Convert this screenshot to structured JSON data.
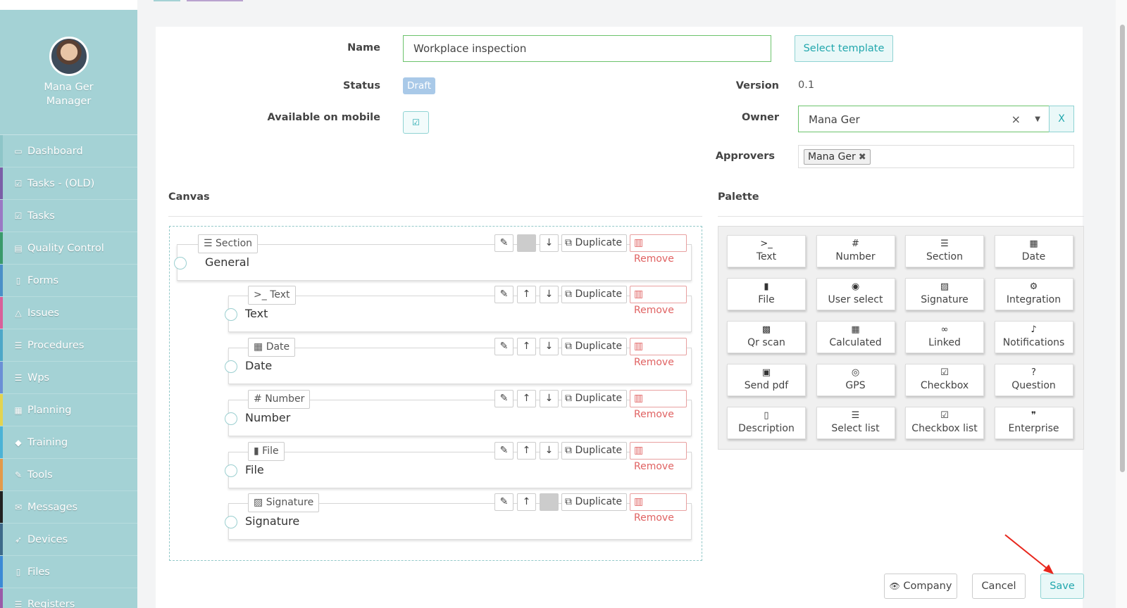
{
  "sidebar": {
    "user_name": "Mana Ger",
    "user_role": "Manager",
    "items": [
      {
        "label": "Dashboard",
        "icon": "monitor-icon",
        "glyph": "▭",
        "color": "#8ec5c8"
      },
      {
        "label": "Tasks - (OLD)",
        "icon": "check-square-icon",
        "glyph": "☑",
        "color": "#7b5ea7"
      },
      {
        "label": "Tasks",
        "icon": "check-square-icon",
        "glyph": "☑",
        "color": "#9a78c4"
      },
      {
        "label": "Quality Control",
        "icon": "book-icon",
        "glyph": "▤",
        "color": "#3a9a6b"
      },
      {
        "label": "Forms",
        "icon": "file-icon",
        "glyph": "▯",
        "color": "#4a90c8"
      },
      {
        "label": "Issues",
        "icon": "bell-icon",
        "glyph": "△",
        "color": "#d9609a"
      },
      {
        "label": "Procedures",
        "icon": "list-icon",
        "glyph": "☰",
        "color": "#4da7c8"
      },
      {
        "label": "Wps",
        "icon": "list-icon",
        "glyph": "☰",
        "color": "#6b8fd6"
      },
      {
        "label": "Planning",
        "icon": "calendar-icon",
        "glyph": "▦",
        "color": "#e3d450"
      },
      {
        "label": "Training",
        "icon": "graduation-icon",
        "glyph": "◆",
        "color": "#4bb3d6"
      },
      {
        "label": "Tools",
        "icon": "wrench-icon",
        "glyph": "✎",
        "color": "#e39a4a"
      },
      {
        "label": "Messages",
        "icon": "envelope-icon",
        "glyph": "✉",
        "color": "#222222"
      },
      {
        "label": "Devices",
        "icon": "rocket-icon",
        "glyph": "➶",
        "color": "#3e6a8a"
      },
      {
        "label": "Files",
        "icon": "pdf-icon",
        "glyph": "▯",
        "color": "#3c8ad6"
      },
      {
        "label": "Registers",
        "icon": "list-icon",
        "glyph": "☰",
        "color": "#9a5aa8"
      }
    ]
  },
  "form": {
    "name_label": "Name",
    "name_value": "Workplace inspection",
    "select_template": "Select template",
    "status_label": "Status",
    "status_value": "Draft",
    "version_label": "Version",
    "version_value": "0.1",
    "mobile_label": "Available on mobile",
    "owner_label": "Owner",
    "owner_value": "Mana Ger",
    "owner_clear": "×",
    "owner_x": "X",
    "approvers_label": "Approvers",
    "approver_tag": "Mana Ger"
  },
  "canvas": {
    "title": "Canvas",
    "components": [
      {
        "type": "Section",
        "type_glyph": "☰",
        "label": "General",
        "up_disabled": true,
        "down_disabled": false
      },
      {
        "type": "Text",
        "type_glyph": ">_",
        "label": "Text",
        "up_disabled": false,
        "down_disabled": false
      },
      {
        "type": "Date",
        "type_glyph": "▦",
        "label": "Date",
        "up_disabled": false,
        "down_disabled": false
      },
      {
        "type": "Number",
        "type_glyph": "#",
        "label": "Number",
        "up_disabled": false,
        "down_disabled": false
      },
      {
        "type": "File",
        "type_glyph": "▮",
        "label": "File",
        "up_disabled": false,
        "down_disabled": false
      },
      {
        "type": "Signature",
        "type_glyph": "▨",
        "label": "Signature",
        "up_disabled": false,
        "down_disabled": true
      }
    ],
    "duplicate_label": "Duplicate",
    "remove_label": "Remove"
  },
  "palette": {
    "title": "Palette",
    "items": [
      {
        "label": "Text",
        "glyph": ">_"
      },
      {
        "label": "Number",
        "glyph": "#"
      },
      {
        "label": "Section",
        "glyph": "☰"
      },
      {
        "label": "Date",
        "glyph": "▦"
      },
      {
        "label": "File",
        "glyph": "▮"
      },
      {
        "label": "User select",
        "glyph": "◉"
      },
      {
        "label": "Signature",
        "glyph": "▨"
      },
      {
        "label": "Integration",
        "glyph": "⚙"
      },
      {
        "label": "Qr scan",
        "glyph": "▩"
      },
      {
        "label": "Calculated",
        "glyph": "▦"
      },
      {
        "label": "Linked",
        "glyph": "∞"
      },
      {
        "label": "Notifications",
        "glyph": "♪"
      },
      {
        "label": "Send pdf",
        "glyph": "▣"
      },
      {
        "label": "GPS",
        "glyph": "◎"
      },
      {
        "label": "Checkbox",
        "glyph": "☑"
      },
      {
        "label": "Question",
        "glyph": "?"
      },
      {
        "label": "Description",
        "glyph": "▯"
      },
      {
        "label": "Select list",
        "glyph": "☰"
      },
      {
        "label": "Checkbox list",
        "glyph": "☑"
      },
      {
        "label": "Enterprise",
        "glyph": "❞"
      }
    ]
  },
  "footer": {
    "company": "Company",
    "cancel": "Cancel",
    "save": "Save"
  },
  "colors": {
    "sidebar_bg": "#a4d2d5",
    "accent": "#21a7ad",
    "remove": "#e06262",
    "annotation_arrow": "#e8271d"
  }
}
